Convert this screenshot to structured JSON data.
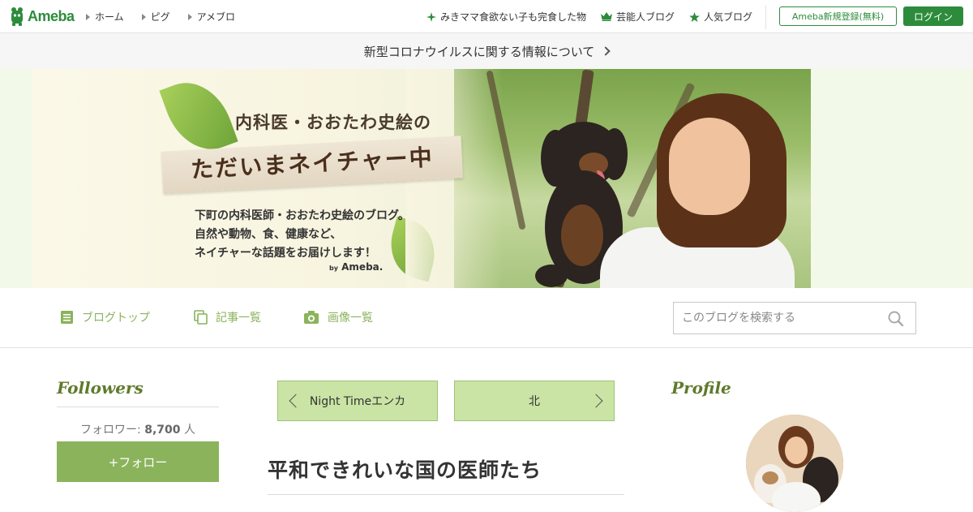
{
  "header": {
    "logo_text": "Ameba",
    "nav": [
      {
        "label": "ホーム"
      },
      {
        "label": "ピグ"
      },
      {
        "label": "アメブロ"
      }
    ],
    "right_links": [
      {
        "label": "みきママ食欲ない子も完食した物",
        "icon": "sparkle-icon"
      },
      {
        "label": "芸能人ブログ",
        "icon": "crown-icon"
      },
      {
        "label": "人気ブログ",
        "icon": "star-icon"
      }
    ],
    "register_label": "Ameba新規登録(無料)",
    "login_label": "ログイン"
  },
  "notice": {
    "text": "新型コロナウイルスに関する情報について"
  },
  "banner": {
    "subtitle": "内科医・おおたわ史絵の",
    "title": "ただいまネイチャー中",
    "desc_lines": [
      "下町の内科医師・おおたわ史絵のブログ。",
      "自然や動物、食、健康など、",
      "ネイチャーな話題をお届けします！"
    ],
    "by_label": "by",
    "by_brand": "Ameba."
  },
  "blog_nav": {
    "items": [
      {
        "label": "ブログトップ",
        "icon": "document-icon"
      },
      {
        "label": "記事一覧",
        "icon": "copy-icon"
      },
      {
        "label": "画像一覧",
        "icon": "camera-icon"
      }
    ],
    "search_placeholder": "このブログを検索する"
  },
  "followers": {
    "title": "Followers",
    "label": "フォロワー:",
    "count": "8,700",
    "unit": "人",
    "follow_button": "+フォロー"
  },
  "pager": {
    "prev": "Night Timeエンカ",
    "next": "北"
  },
  "entry": {
    "title": "平和できれいな国の医師たち"
  },
  "profile": {
    "title": "Profile"
  },
  "colors": {
    "brand_green": "#2d8c3c",
    "blog_accent": "#8bb35c",
    "pager_bg": "#c9e4a4"
  }
}
